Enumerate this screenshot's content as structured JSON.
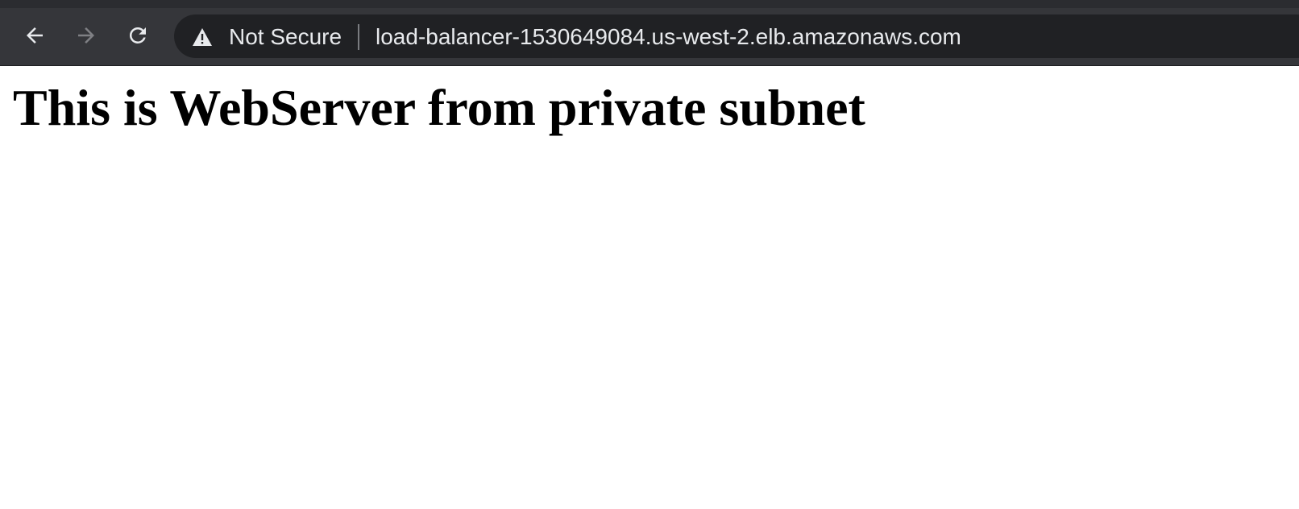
{
  "browser": {
    "nav": {
      "back_icon": "arrow-left-icon",
      "forward_icon": "arrow-right-icon",
      "reload_icon": "reload-icon"
    },
    "omnibox": {
      "security_icon": "warning-triangle-icon",
      "security_label": "Not Secure",
      "url": "load-balancer-1530649084.us-west-2.elb.amazonaws.com"
    },
    "colors": {
      "toolbar": "#35363a",
      "omnibox": "#202124",
      "text": "#e8eaed"
    }
  },
  "page": {
    "heading": "This is WebServer from private subnet"
  }
}
